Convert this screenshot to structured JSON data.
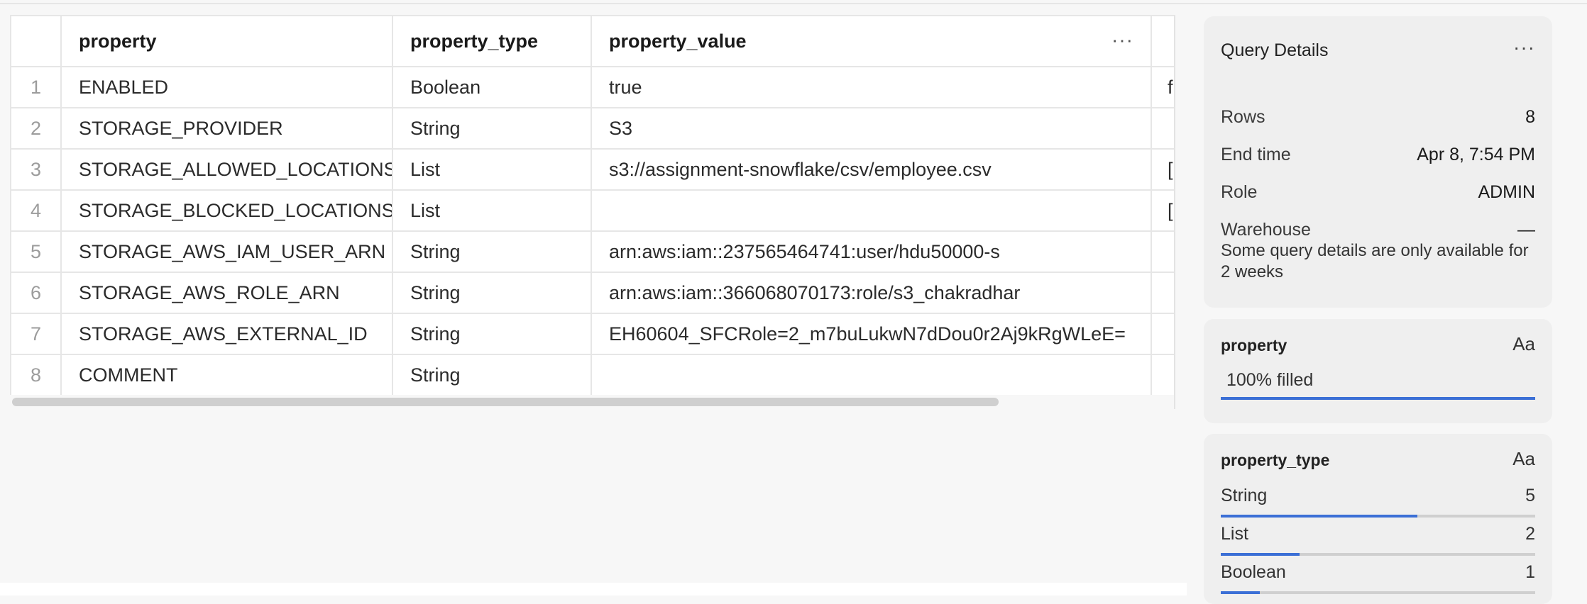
{
  "grid": {
    "columns": [
      "property",
      "property_type",
      "property_value"
    ],
    "column_menu": "···",
    "rows": [
      {
        "n": "1",
        "property": "ENABLED",
        "property_type": "Boolean",
        "property_value": "true",
        "extra": "f"
      },
      {
        "n": "2",
        "property": "STORAGE_PROVIDER",
        "property_type": "String",
        "property_value": "S3",
        "extra": ""
      },
      {
        "n": "3",
        "property": "STORAGE_ALLOWED_LOCATIONS",
        "property_type": "List",
        "property_value": "s3://assignment-snowflake/csv/employee.csv",
        "extra": "["
      },
      {
        "n": "4",
        "property": "STORAGE_BLOCKED_LOCATIONS",
        "property_type": "List",
        "property_value": "",
        "extra": "["
      },
      {
        "n": "5",
        "property": "STORAGE_AWS_IAM_USER_ARN",
        "property_type": "String",
        "property_value": "arn:aws:iam::237565464741:user/hdu50000-s",
        "extra": ""
      },
      {
        "n": "6",
        "property": "STORAGE_AWS_ROLE_ARN",
        "property_type": "String",
        "property_value": "arn:aws:iam::366068070173:role/s3_chakradhar",
        "extra": ""
      },
      {
        "n": "7",
        "property": "STORAGE_AWS_EXTERNAL_ID",
        "property_type": "String",
        "property_value": "EH60604_SFCRole=2_m7buLukwN7dDou0r2Aj9kRgWLeE=",
        "extra": ""
      },
      {
        "n": "8",
        "property": "COMMENT",
        "property_type": "String",
        "property_value": "",
        "extra": ""
      }
    ]
  },
  "details": {
    "title": "Query Details",
    "menu": "···",
    "rows_label": "Rows",
    "rows_value": "8",
    "end_label": "End time",
    "end_value": "Apr 8, 7:54 PM",
    "role_label": "Role",
    "role_value": "ADMIN",
    "warehouse_label": "Warehouse",
    "warehouse_value": "—",
    "note": "Some query details are only available for 2 weeks"
  },
  "stats_property": {
    "name": "property",
    "type_icon": "Aa",
    "filled_text": "100% filled",
    "filled_fraction": 1.0
  },
  "stats_property_type": {
    "name": "property_type",
    "type_icon": "Aa",
    "values": [
      {
        "label": "String",
        "count": "5",
        "fraction": 0.625
      },
      {
        "label": "List",
        "count": "2",
        "fraction": 0.25
      },
      {
        "label": "Boolean",
        "count": "1",
        "fraction": 0.125
      }
    ]
  },
  "colors": {
    "accent": "#3b6fd6",
    "panel": "#efefef",
    "track": "#cfcfcf"
  }
}
